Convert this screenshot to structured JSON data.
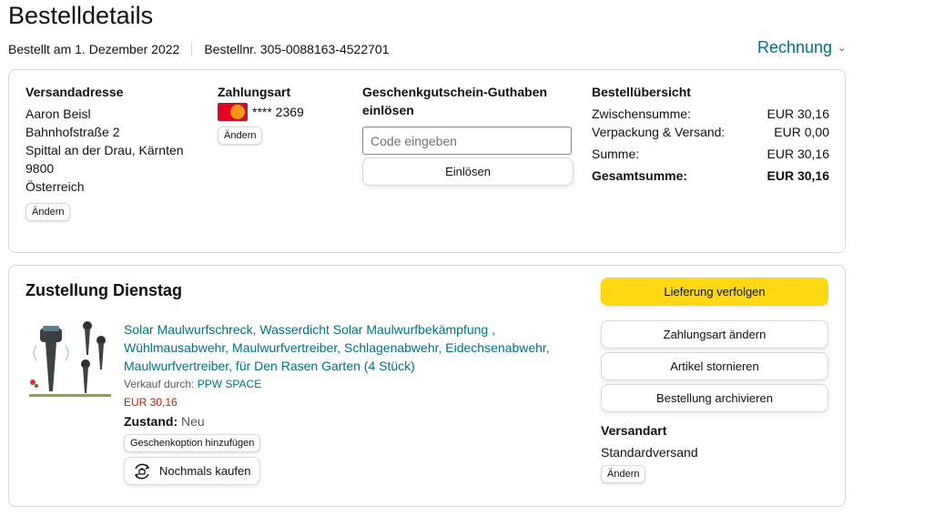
{
  "page": {
    "title": "Bestelldetails",
    "ordered_on": "Bestellt am 1. Dezember 2022",
    "order_number": "Bestellnr. 305-0088163-4522701",
    "invoice_label": "Rechnung"
  },
  "shipping_address": {
    "title": "Versandadresse",
    "name": "Aaron Beisl",
    "street": "Bahnhofstraße 2",
    "city": "Spittal an der Drau, Kärnten",
    "zip": "9800",
    "country": "Österreich",
    "change_label": "Ändern"
  },
  "payment": {
    "title": "Zahlungsart",
    "card_icon": "mastercard-icon",
    "card_number": "**** 2369",
    "change_label": "Ändern"
  },
  "gift_card": {
    "title": "Geschenkgutschein-Guthaben einlösen",
    "placeholder": "Code eingeben",
    "redeem_label": "Einlösen"
  },
  "summary": {
    "title": "Bestellübersicht",
    "rows": [
      {
        "label": "Zwischensumme:",
        "value": "EUR 30,16"
      },
      {
        "label": "Verpackung & Versand:",
        "value": "EUR 0,00"
      },
      {
        "label": "Summe:",
        "value": "EUR 30,16"
      },
      {
        "label": "Gesamtsumme:",
        "value": "EUR 30,16"
      }
    ]
  },
  "delivery": {
    "title": "Zustellung Dienstag",
    "product": {
      "name": "Solar Maulwurfschreck, Wasserdicht Solar Maulwurfbekämpfung , Wühlmausabwehr, Maulwurfvertreiber, Schlagenabwehr, Eidechsenabwehr, Maulwurfvertreiber, für Den Rasen Garten (4 Stück)",
      "seller_label": "Verkauf durch:",
      "seller": "PPW SPACE",
      "price": "EUR 30,16",
      "condition_label": "Zustand:",
      "condition": "Neu",
      "gift_option_label": "Geschenkoption hinzufügen",
      "buy_again_label": "Nochmals kaufen"
    },
    "actions": {
      "track": "Lieferung verfolgen",
      "change_payment": "Zahlungsart ändern",
      "cancel": "Artikel stornieren",
      "archive": "Bestellung archivieren"
    },
    "shipping_method": {
      "title": "Versandart",
      "value": "Standardversand",
      "change_label": "Ändern"
    }
  },
  "colors": {
    "link": "#007185",
    "price": "#b12704",
    "primary_button": "#ffd814",
    "border": "#d5d9d9"
  }
}
